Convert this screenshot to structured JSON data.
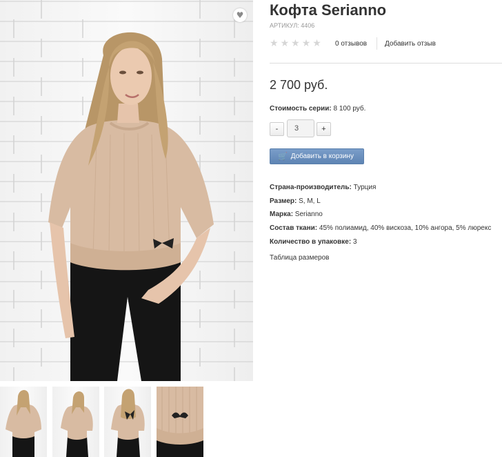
{
  "product": {
    "title": "Кофта Serianno",
    "sku": "АРТИКУЛ: 4406",
    "reviews_count": "0 отзывов",
    "add_review": "Добавить отзыв",
    "rating": 0,
    "rating_max": 5,
    "price": "2 700 руб.",
    "series_label": "Стоимость серии:",
    "series_value": " 8 100 руб.",
    "qty_minus": "-",
    "qty_value": "3",
    "qty_plus": "+",
    "add_to_cart": "Добавить в корзину",
    "size_table": "Таблица размеров",
    "accent_color": "#6b8fbf"
  },
  "specs": [
    {
      "key": "Страна-производитель:",
      "value": " Турция"
    },
    {
      "key": "Размер:",
      "value": " S, M, L"
    },
    {
      "key": "Марка:",
      "value": " Serianno"
    },
    {
      "key": "Состав ткани:",
      "value": " 45% полиамид, 40% вискоза, 10% ангора, 5% люрекс"
    },
    {
      "key": "Количество в упаковке:",
      "value": " 3"
    }
  ],
  "gallery": {
    "favorite_icon": "heart-icon",
    "thumbnail_count": 4
  }
}
